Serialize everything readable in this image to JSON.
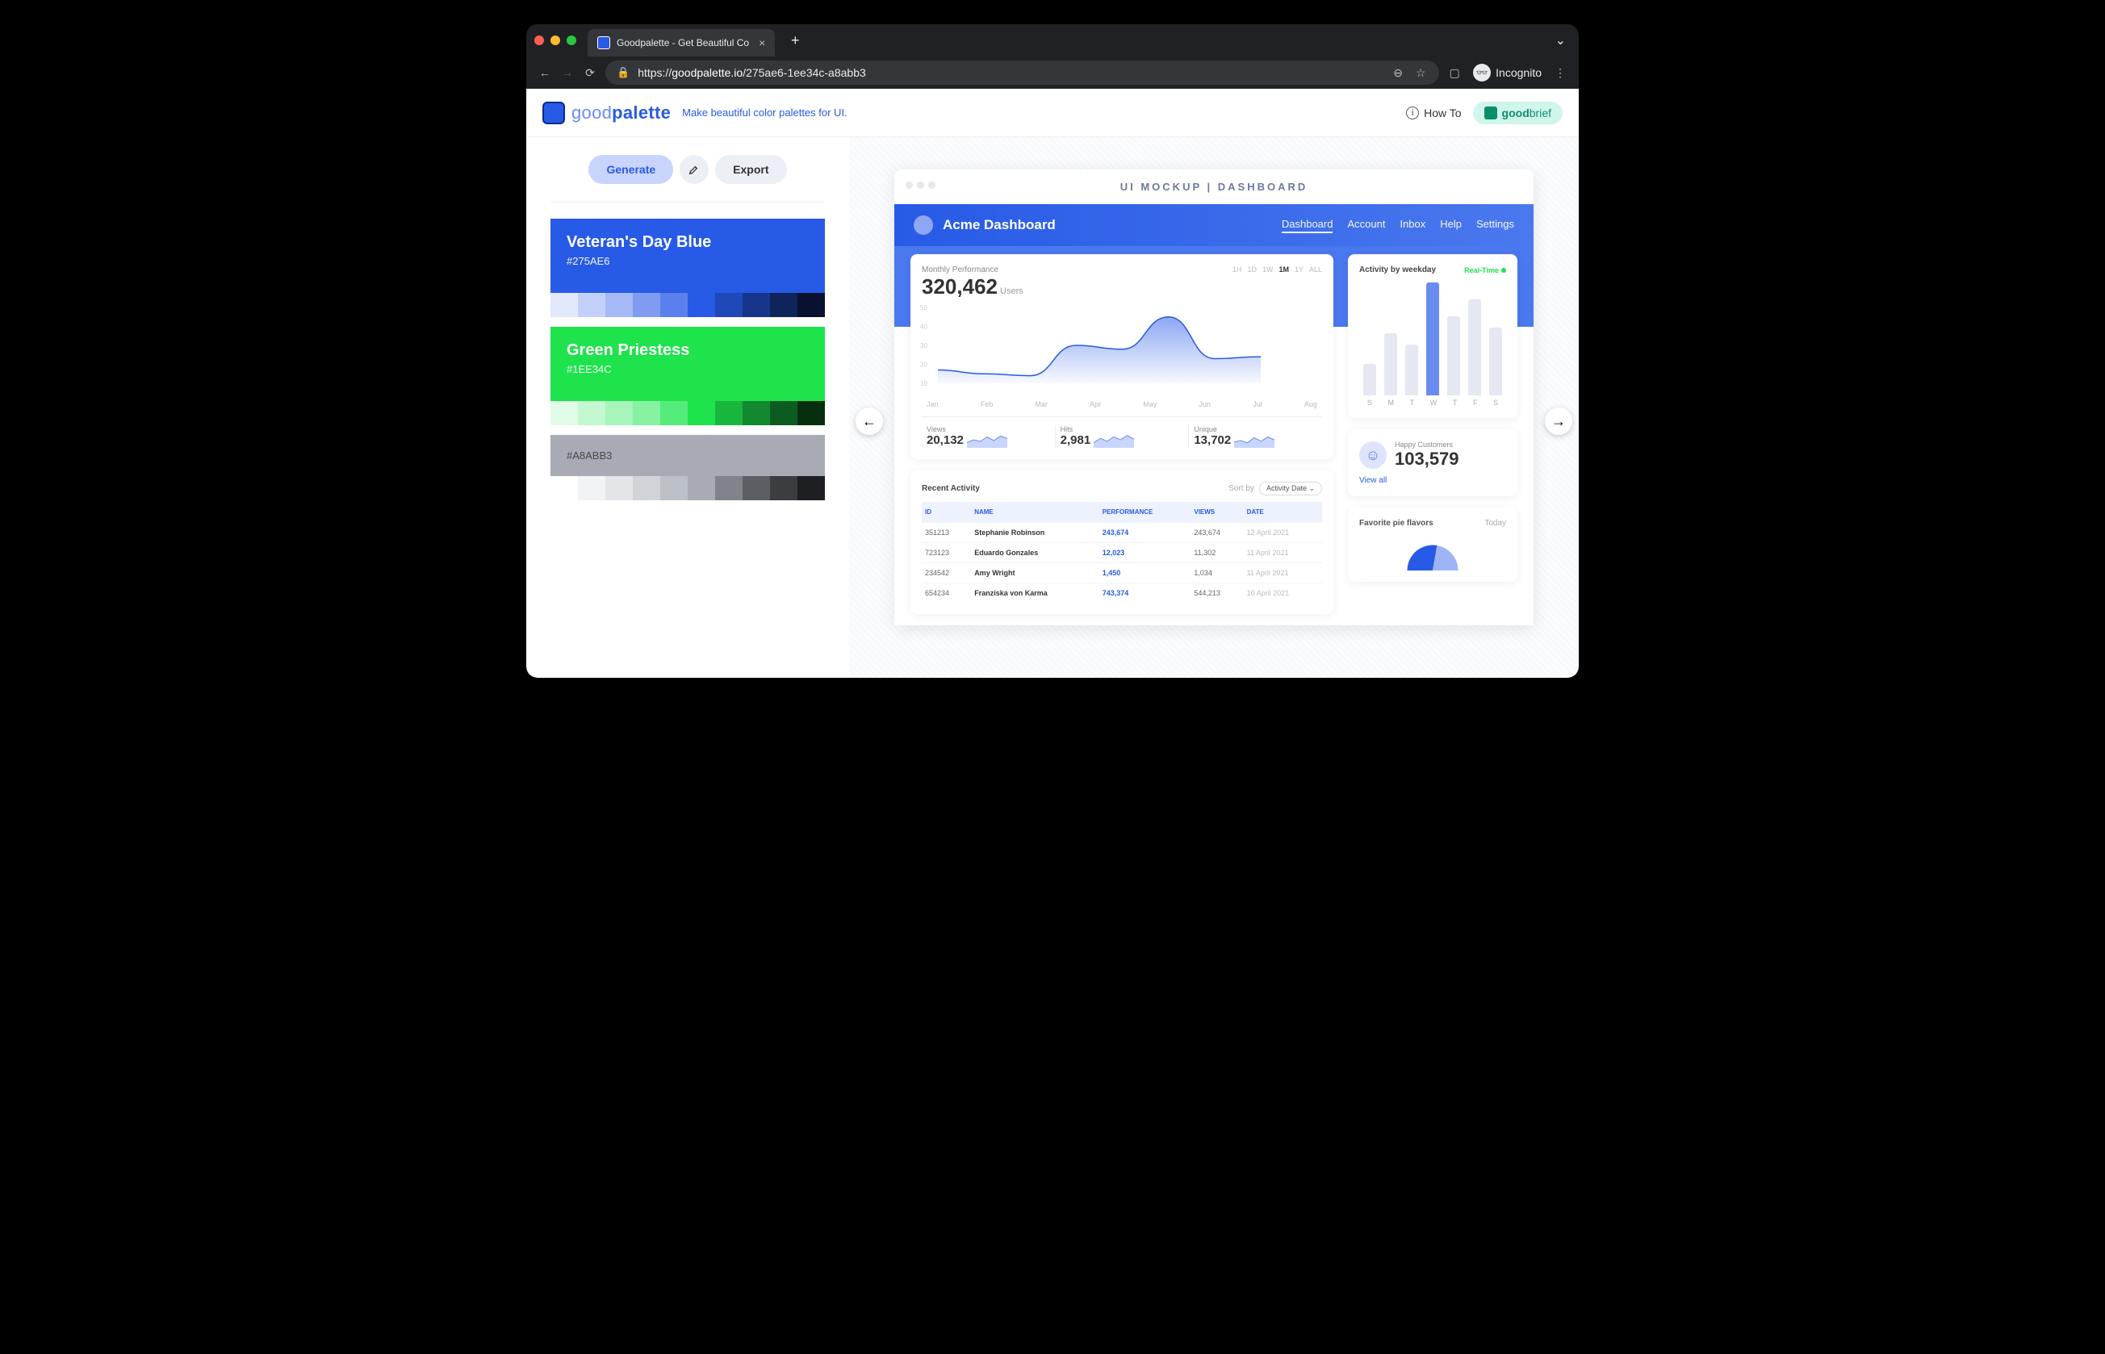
{
  "browser": {
    "tab_title": "Goodpalette - Get Beautiful Co",
    "url_prefix": "https://",
    "url_domain": "goodpalette.io",
    "url_path": "/275ae6-1ee34c-a8abb3",
    "incognito": "Incognito"
  },
  "site": {
    "logo_good": "good",
    "logo_palette": "palette",
    "tagline": "Make beautiful color palettes for UI.",
    "howto": "How To",
    "goodbrief_good": "good",
    "goodbrief_brief": "brief"
  },
  "controls": {
    "generate": "Generate",
    "export": "Export"
  },
  "palettes": [
    {
      "name": "Veteran's Day Blue",
      "hex": "#275AE6",
      "headbg": "#275AE6",
      "swatches": [
        "#e3e9fd",
        "#c3d1fa",
        "#a4b9f6",
        "#7f9cf2",
        "#5c7fee",
        "#275AE6",
        "#1f48b8",
        "#17368a",
        "#10245c",
        "#081230"
      ]
    },
    {
      "name": "Green Priestess",
      "hex": "#1EE34C",
      "headbg": "#1EE34C",
      "swatches": [
        "#e1fce8",
        "#c4f8d1",
        "#a7f5bb",
        "#86f2a2",
        "#55eb7a",
        "#1EE34C",
        "#18b63d",
        "#12892e",
        "#0c5c1f",
        "#062f10"
      ]
    },
    {
      "name": "",
      "hex": "#A8ABB3",
      "headbg": "#A8ABB3",
      "swatches": [
        "#ffffff",
        "#f2f3f5",
        "#e3e5e8",
        "#d1d4d9",
        "#bcc0c7",
        "#A8ABB3",
        "#80838a",
        "#5b5e63",
        "#3b3d41",
        "#1e1f22"
      ]
    }
  ],
  "mockup": {
    "label": "UI MOCKUP | DASHBOARD",
    "title": "Acme Dashboard",
    "nav": [
      "Dashboard",
      "Account",
      "Inbox",
      "Help",
      "Settings"
    ],
    "perf_title": "Monthly Performance",
    "perf_val": "320,462",
    "perf_unit": " Users",
    "ranges": [
      "1H",
      "1D",
      "1W",
      "1M",
      "1Y",
      "ALL"
    ],
    "range_sel": "1M",
    "months": [
      "Jan",
      "Feb",
      "Mar",
      "Apr",
      "May",
      "Jun",
      "Jul",
      "Aug"
    ],
    "mini": [
      {
        "l": "Views",
        "v": "20,132"
      },
      {
        "l": "Hits",
        "v": "2,981"
      },
      {
        "l": "Unique",
        "v": "13,702"
      }
    ],
    "weekday_title": "Activity by weekday",
    "realtime": "Real-Time",
    "days": [
      "S",
      "M",
      "T",
      "W",
      "T",
      "F",
      "S"
    ],
    "happy_label": "Happy Customers",
    "happy_val": "103,579",
    "viewall": "View all",
    "pie_title": "Favorite pie flavors",
    "pie_when": "Today",
    "table": {
      "title": "Recent Activity",
      "sortby": "Sort by",
      "sortsel": "Activity Date",
      "cols": [
        "ID",
        "NAME",
        "PERFORMANCE",
        "VIEWS",
        "DATE"
      ],
      "rows": [
        {
          "id": "351213",
          "name": "Stephanie Robinson",
          "perf": "243,674",
          "views": "243,674",
          "date": "12 April 2021"
        },
        {
          "id": "723123",
          "name": "Eduardo Gonzales",
          "perf": "12,023",
          "views": "11,302",
          "date": "11 April 2021"
        },
        {
          "id": "234542",
          "name": "Amy Wright",
          "perf": "1,450",
          "views": "1,034",
          "date": "11 April 2021"
        },
        {
          "id": "654234",
          "name": "Franziska von Karma",
          "perf": "743,374",
          "views": "544,213",
          "date": "10 April 2021"
        }
      ]
    }
  },
  "chart_data": {
    "line": {
      "type": "area",
      "x": [
        "Jan",
        "Feb",
        "Mar",
        "Apr",
        "May",
        "Jun",
        "Jul",
        "Aug"
      ],
      "values": [
        17,
        15,
        14,
        30,
        28,
        45,
        23,
        24
      ],
      "ylim": [
        10,
        50
      ],
      "yticks": [
        10,
        20,
        30,
        40,
        50
      ]
    },
    "bars": {
      "type": "bar",
      "categories": [
        "S",
        "M",
        "T",
        "W",
        "T",
        "F",
        "S"
      ],
      "values": [
        28,
        55,
        45,
        100,
        70,
        85,
        60
      ]
    },
    "sparks": [
      [
        15,
        22,
        18,
        30,
        20,
        32,
        26
      ],
      [
        14,
        26,
        18,
        30,
        22,
        34,
        24
      ],
      [
        16,
        20,
        14,
        28,
        18,
        30,
        22
      ]
    ],
    "pie": {
      "type": "pie",
      "values": [
        55,
        45
      ],
      "colors": [
        "#275AE6",
        "#9db4f6"
      ]
    }
  }
}
